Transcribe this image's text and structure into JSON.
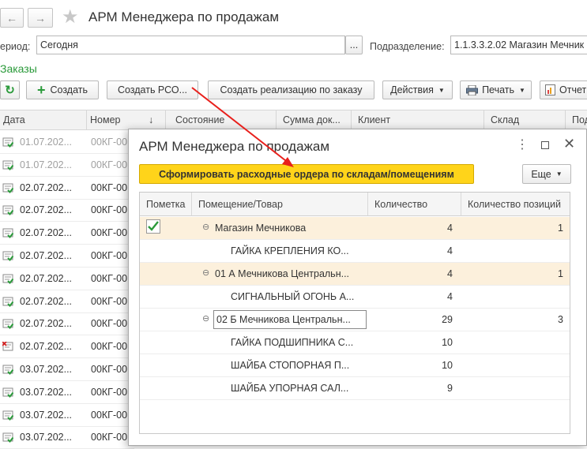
{
  "window": {
    "title": "АРМ Менеджера по продажам"
  },
  "filters": {
    "period_label": "ериод:",
    "period_value": "Сегодня",
    "period_btn": "...",
    "division_label": "Подразделение:",
    "division_value": "1.1.3.3.2.02 Магазин Мечник"
  },
  "section_title": "Заказы",
  "toolbar": {
    "create": "Создать",
    "create_rso": "Создать РСО...",
    "create_realization": "Создать реализацию по заказу",
    "actions": "Действия",
    "print": "Печать",
    "reports": "Отчет"
  },
  "table": {
    "headers": {
      "date": "Дата",
      "number": "Номер",
      "sort_arrow": "↓",
      "state": "Состояние",
      "sum": "Сумма док...",
      "client": "Клиент",
      "warehouse": "Склад",
      "extra": "Под"
    },
    "rows": [
      {
        "date": "01.07.202...",
        "num": "00КГ-00",
        "icon": "doc-posted",
        "dim": true
      },
      {
        "date": "01.07.202...",
        "num": "00КГ-00",
        "icon": "doc-posted",
        "dim": true
      },
      {
        "date": "02.07.202...",
        "num": "00КГ-00",
        "icon": "doc-posted",
        "dim": false
      },
      {
        "date": "02.07.202...",
        "num": "00КГ-00",
        "icon": "doc-posted",
        "dim": false
      },
      {
        "date": "02.07.202...",
        "num": "00КГ-00",
        "icon": "doc-posted",
        "dim": false
      },
      {
        "date": "02.07.202...",
        "num": "00КГ-00",
        "icon": "doc-posted",
        "dim": false
      },
      {
        "date": "02.07.202...",
        "num": "00КГ-00",
        "icon": "doc-posted",
        "dim": false
      },
      {
        "date": "02.07.202...",
        "num": "00КГ-00",
        "icon": "doc-posted",
        "dim": false
      },
      {
        "date": "02.07.202...",
        "num": "00КГ-00",
        "icon": "doc-posted",
        "dim": false
      },
      {
        "date": "02.07.202...",
        "num": "00КГ-00",
        "icon": "doc-deleted",
        "dim": false
      },
      {
        "date": "03.07.202...",
        "num": "00КГ-00",
        "icon": "doc-posted",
        "dim": false
      },
      {
        "date": "03.07.202...",
        "num": "00КГ-00",
        "icon": "doc-posted",
        "dim": false
      },
      {
        "date": "03.07.202...",
        "num": "00КГ-00",
        "icon": "doc-posted",
        "dim": false
      },
      {
        "date": "03.07.202...",
        "num": "00КГ-00",
        "icon": "doc-posted",
        "dim": false
      }
    ]
  },
  "modal": {
    "title": "АРМ Менеджера по продажам",
    "primary_button": "Сформировать расходные ордера по складам/помещениям",
    "more_button": "Еще",
    "columns": {
      "mark": "Пометка",
      "place": "Помещение/Товар",
      "qty": "Количество",
      "positions": "Количество позиций"
    },
    "rows": [
      {
        "kind": "group",
        "checked": true,
        "name": "Магазин Мечникова",
        "qty": "4",
        "positions": "1"
      },
      {
        "kind": "item",
        "name": "ГАЙКА КРЕПЛЕНИЯ КО...",
        "qty": "4",
        "positions": ""
      },
      {
        "kind": "group",
        "checked": false,
        "name": "01 А Мечникова Центральн...",
        "qty": "4",
        "positions": "1"
      },
      {
        "kind": "item",
        "name": "СИГНАЛЬНЫЙ ОГОНЬ А...",
        "qty": "4",
        "positions": ""
      },
      {
        "kind": "group-selected",
        "checked": false,
        "name": "02 Б Мечникова Центральн...",
        "qty": "29",
        "positions": "3"
      },
      {
        "kind": "item",
        "name": "ГАЙКА ПОДШИПНИКА С...",
        "qty": "10",
        "positions": ""
      },
      {
        "kind": "item",
        "name": "ШАЙБА СТОПОРНАЯ П...",
        "qty": "10",
        "positions": ""
      },
      {
        "kind": "item",
        "name": "ШАЙБА УПОРНАЯ САЛ...",
        "qty": "9",
        "positions": ""
      }
    ]
  },
  "colors": {
    "accent_green": "#2a9a3a",
    "primary_yellow": "#ffd41a",
    "highlight_row": "#fcf0dc",
    "arrow_red": "#e8201c"
  }
}
